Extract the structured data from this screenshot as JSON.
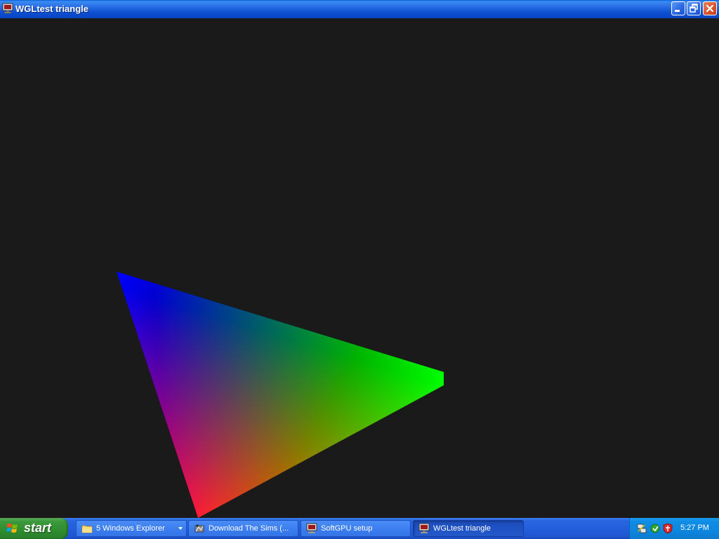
{
  "window": {
    "title": "WGLtest triangle",
    "icon": "monitor-icon"
  },
  "render": {
    "background": "#1a1a1a",
    "vertex_colors": [
      "#0000ff",
      "#00ff00",
      "#ff0000"
    ]
  },
  "taskbar": {
    "start_label": "start",
    "tasks": [
      {
        "label": "5 Windows Explorer",
        "icon": "folder-icon",
        "has_group_arrow": true,
        "active": false
      },
      {
        "label": "Download The Sims (...",
        "icon": "sims-icon",
        "active": false
      },
      {
        "label": "SoftGPU setup",
        "icon": "monitor-icon",
        "active": false
      },
      {
        "label": "WGLtest triangle",
        "icon": "monitor-icon",
        "active": true
      }
    ],
    "tray": {
      "icons": [
        "network-icon",
        "update-icon",
        "security-shield-icon"
      ],
      "clock": "5:27 PM"
    }
  }
}
